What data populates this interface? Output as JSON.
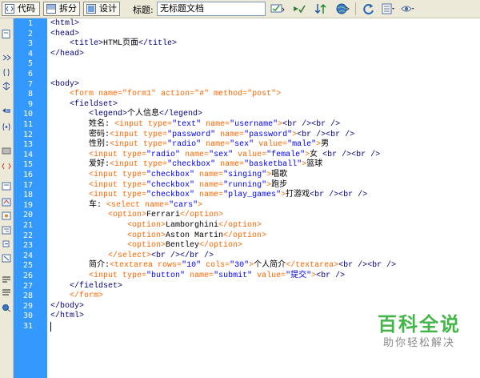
{
  "toolbar": {
    "code_label": "代码",
    "split_label": "拆分",
    "design_label": "设计",
    "title_label": "标题:",
    "title_value": "无标题文档"
  },
  "line_numbers": [
    "1",
    "2",
    "3",
    "4",
    "5",
    "6",
    "7",
    "8",
    "9",
    "10",
    "11",
    "12",
    "13",
    "14",
    "15",
    "16",
    "17",
    "18",
    "19",
    "20",
    "21",
    "22",
    "23",
    "24",
    "25",
    "26",
    "27",
    "28",
    "29",
    "30",
    "31"
  ],
  "code_lines": [
    [
      {
        "t": "<html>",
        "c": "tg"
      }
    ],
    [
      {
        "t": "<head>",
        "c": "tg"
      }
    ],
    [
      {
        "t": "    <title>",
        "c": "tg"
      },
      {
        "t": "HTML页面",
        "c": "tx"
      },
      {
        "t": "</title>",
        "c": "tg"
      }
    ],
    [
      {
        "t": "</head>",
        "c": "tg"
      }
    ],
    [],
    [],
    [
      {
        "t": "<body>",
        "c": "tg"
      }
    ],
    [
      {
        "t": "    <form ",
        "c": "ft"
      },
      {
        "t": "name=",
        "c": "ft"
      },
      {
        "t": "\"form1\"",
        "c": "ft"
      },
      {
        "t": " action=",
        "c": "ft"
      },
      {
        "t": "\"#\"",
        "c": "ft"
      },
      {
        "t": " method=",
        "c": "ft"
      },
      {
        "t": "\"post\"",
        "c": "ft"
      },
      {
        "t": ">",
        "c": "ft"
      }
    ],
    [
      {
        "t": "    <fieldset>",
        "c": "tg"
      }
    ],
    [
      {
        "t": "        <legend>",
        "c": "tg"
      },
      {
        "t": "个人信息",
        "c": "tx"
      },
      {
        "t": "</legend>",
        "c": "tg"
      }
    ],
    [
      {
        "t": "        ",
        "c": "tx"
      },
      {
        "t": "姓名:",
        "c": "tx"
      },
      {
        "t": " <input ",
        "c": "ft"
      },
      {
        "t": "type=",
        "c": "ft"
      },
      {
        "t": "\"text\"",
        "c": "av"
      },
      {
        "t": " name=",
        "c": "ft"
      },
      {
        "t": "\"username\"",
        "c": "av"
      },
      {
        "t": ">",
        "c": "ft"
      },
      {
        "t": "<br />",
        "c": "tg"
      },
      {
        "t": "<br />",
        "c": "tg"
      }
    ],
    [
      {
        "t": "        ",
        "c": "tx"
      },
      {
        "t": "密码:",
        "c": "tx"
      },
      {
        "t": "<input ",
        "c": "ft"
      },
      {
        "t": "type=",
        "c": "ft"
      },
      {
        "t": "\"password\"",
        "c": "av"
      },
      {
        "t": " name=",
        "c": "ft"
      },
      {
        "t": "\"password\"",
        "c": "av"
      },
      {
        "t": ">",
        "c": "ft"
      },
      {
        "t": "<br />",
        "c": "tg"
      },
      {
        "t": "<br />",
        "c": "tg"
      }
    ],
    [
      {
        "t": "        ",
        "c": "tx"
      },
      {
        "t": "性别:",
        "c": "tx"
      },
      {
        "t": "<input ",
        "c": "ft"
      },
      {
        "t": "type=",
        "c": "ft"
      },
      {
        "t": "\"radio\"",
        "c": "av"
      },
      {
        "t": " name=",
        "c": "ft"
      },
      {
        "t": "\"sex\"",
        "c": "av"
      },
      {
        "t": " value=",
        "c": "ft"
      },
      {
        "t": "\"male\"",
        "c": "av"
      },
      {
        "t": ">",
        "c": "ft"
      },
      {
        "t": "男",
        "c": "tx"
      }
    ],
    [
      {
        "t": "        <input ",
        "c": "ft"
      },
      {
        "t": "type=",
        "c": "ft"
      },
      {
        "t": "\"radio\"",
        "c": "av"
      },
      {
        "t": " name=",
        "c": "ft"
      },
      {
        "t": "\"sex\"",
        "c": "av"
      },
      {
        "t": " value=",
        "c": "ft"
      },
      {
        "t": "\"female\"",
        "c": "av"
      },
      {
        "t": ">",
        "c": "ft"
      },
      {
        "t": "女 ",
        "c": "tx"
      },
      {
        "t": "<br />",
        "c": "tg"
      },
      {
        "t": "<br />",
        "c": "tg"
      }
    ],
    [
      {
        "t": "        ",
        "c": "tx"
      },
      {
        "t": "爱好:",
        "c": "tx"
      },
      {
        "t": "<input ",
        "c": "ft"
      },
      {
        "t": "type=",
        "c": "ft"
      },
      {
        "t": "\"checkbox\"",
        "c": "av"
      },
      {
        "t": " name=",
        "c": "ft"
      },
      {
        "t": "\"basketball\"",
        "c": "av"
      },
      {
        "t": ">",
        "c": "ft"
      },
      {
        "t": "篮球",
        "c": "tx"
      }
    ],
    [
      {
        "t": "        <input ",
        "c": "ft"
      },
      {
        "t": "type=",
        "c": "ft"
      },
      {
        "t": "\"checkbox\"",
        "c": "av"
      },
      {
        "t": " name=",
        "c": "ft"
      },
      {
        "t": "\"singing\"",
        "c": "av"
      },
      {
        "t": ">",
        "c": "ft"
      },
      {
        "t": "唱歌",
        "c": "tx"
      }
    ],
    [
      {
        "t": "        <input ",
        "c": "ft"
      },
      {
        "t": "type=",
        "c": "ft"
      },
      {
        "t": "\"checkbox\"",
        "c": "av"
      },
      {
        "t": " name=",
        "c": "ft"
      },
      {
        "t": "\"running\"",
        "c": "av"
      },
      {
        "t": ">",
        "c": "ft"
      },
      {
        "t": "跑步",
        "c": "tx"
      }
    ],
    [
      {
        "t": "        <input ",
        "c": "ft"
      },
      {
        "t": "type=",
        "c": "ft"
      },
      {
        "t": "\"checkbox\"",
        "c": "av"
      },
      {
        "t": " name=",
        "c": "ft"
      },
      {
        "t": "\"play_games\"",
        "c": "av"
      },
      {
        "t": ">",
        "c": "ft"
      },
      {
        "t": "打游戏",
        "c": "tx"
      },
      {
        "t": "<br />",
        "c": "tg"
      },
      {
        "t": "<br />",
        "c": "tg"
      }
    ],
    [
      {
        "t": "        ",
        "c": "tx"
      },
      {
        "t": "车:",
        "c": "tx"
      },
      {
        "t": " <select ",
        "c": "ft"
      },
      {
        "t": "name=",
        "c": "ft"
      },
      {
        "t": "\"cars\"",
        "c": "av"
      },
      {
        "t": ">",
        "c": "ft"
      }
    ],
    [
      {
        "t": "            <option>",
        "c": "ft"
      },
      {
        "t": "Ferrari",
        "c": "tx"
      },
      {
        "t": "</option>",
        "c": "ft"
      }
    ],
    [
      {
        "t": "                <option>",
        "c": "ft"
      },
      {
        "t": "Lamborghini",
        "c": "tx"
      },
      {
        "t": "</option>",
        "c": "ft"
      }
    ],
    [
      {
        "t": "                <option>",
        "c": "ft"
      },
      {
        "t": "Aston Martin",
        "c": "tx"
      },
      {
        "t": "</option>",
        "c": "ft"
      }
    ],
    [
      {
        "t": "                <option>",
        "c": "ft"
      },
      {
        "t": "Bentley",
        "c": "tx"
      },
      {
        "t": "</option>",
        "c": "ft"
      }
    ],
    [
      {
        "t": "            </select>",
        "c": "ft"
      },
      {
        "t": "<br />",
        "c": "tg"
      },
      {
        "t": "</br />",
        "c": "tg"
      }
    ],
    [
      {
        "t": "        ",
        "c": "tx"
      },
      {
        "t": "简介:",
        "c": "tx"
      },
      {
        "t": "<textarea ",
        "c": "ft"
      },
      {
        "t": "rows=",
        "c": "ft"
      },
      {
        "t": "\"10\"",
        "c": "av"
      },
      {
        "t": " cols=",
        "c": "ft"
      },
      {
        "t": "\"30\"",
        "c": "av"
      },
      {
        "t": ">",
        "c": "ft"
      },
      {
        "t": "个人简介",
        "c": "tx"
      },
      {
        "t": "</textarea>",
        "c": "ft"
      },
      {
        "t": "<br />",
        "c": "tg"
      },
      {
        "t": "<br />",
        "c": "tg"
      }
    ],
    [
      {
        "t": "        <input ",
        "c": "ft"
      },
      {
        "t": "type=",
        "c": "ft"
      },
      {
        "t": "\"button\"",
        "c": "av"
      },
      {
        "t": " name=",
        "c": "ft"
      },
      {
        "t": "\"submit\"",
        "c": "av"
      },
      {
        "t": " value=",
        "c": "ft"
      },
      {
        "t": "\"提交\"",
        "c": "av"
      },
      {
        "t": ">",
        "c": "ft"
      },
      {
        "t": "<br />",
        "c": "tg"
      }
    ],
    [
      {
        "t": "    </fieldset>",
        "c": "tg"
      }
    ],
    [
      {
        "t": "    </form>",
        "c": "ft"
      }
    ],
    [
      {
        "t": "</body>",
        "c": "tg"
      }
    ],
    [
      {
        "t": "</html>",
        "c": "tg"
      }
    ],
    []
  ],
  "watermark": {
    "title": "百科全说",
    "subtitle": "助你轻松解决"
  },
  "colors": {
    "gutter": "#3399ff",
    "tag": "#000080",
    "form_tag": "#ff6600",
    "attr_value": "#0000ff",
    "watermark_green": "#44b549"
  }
}
